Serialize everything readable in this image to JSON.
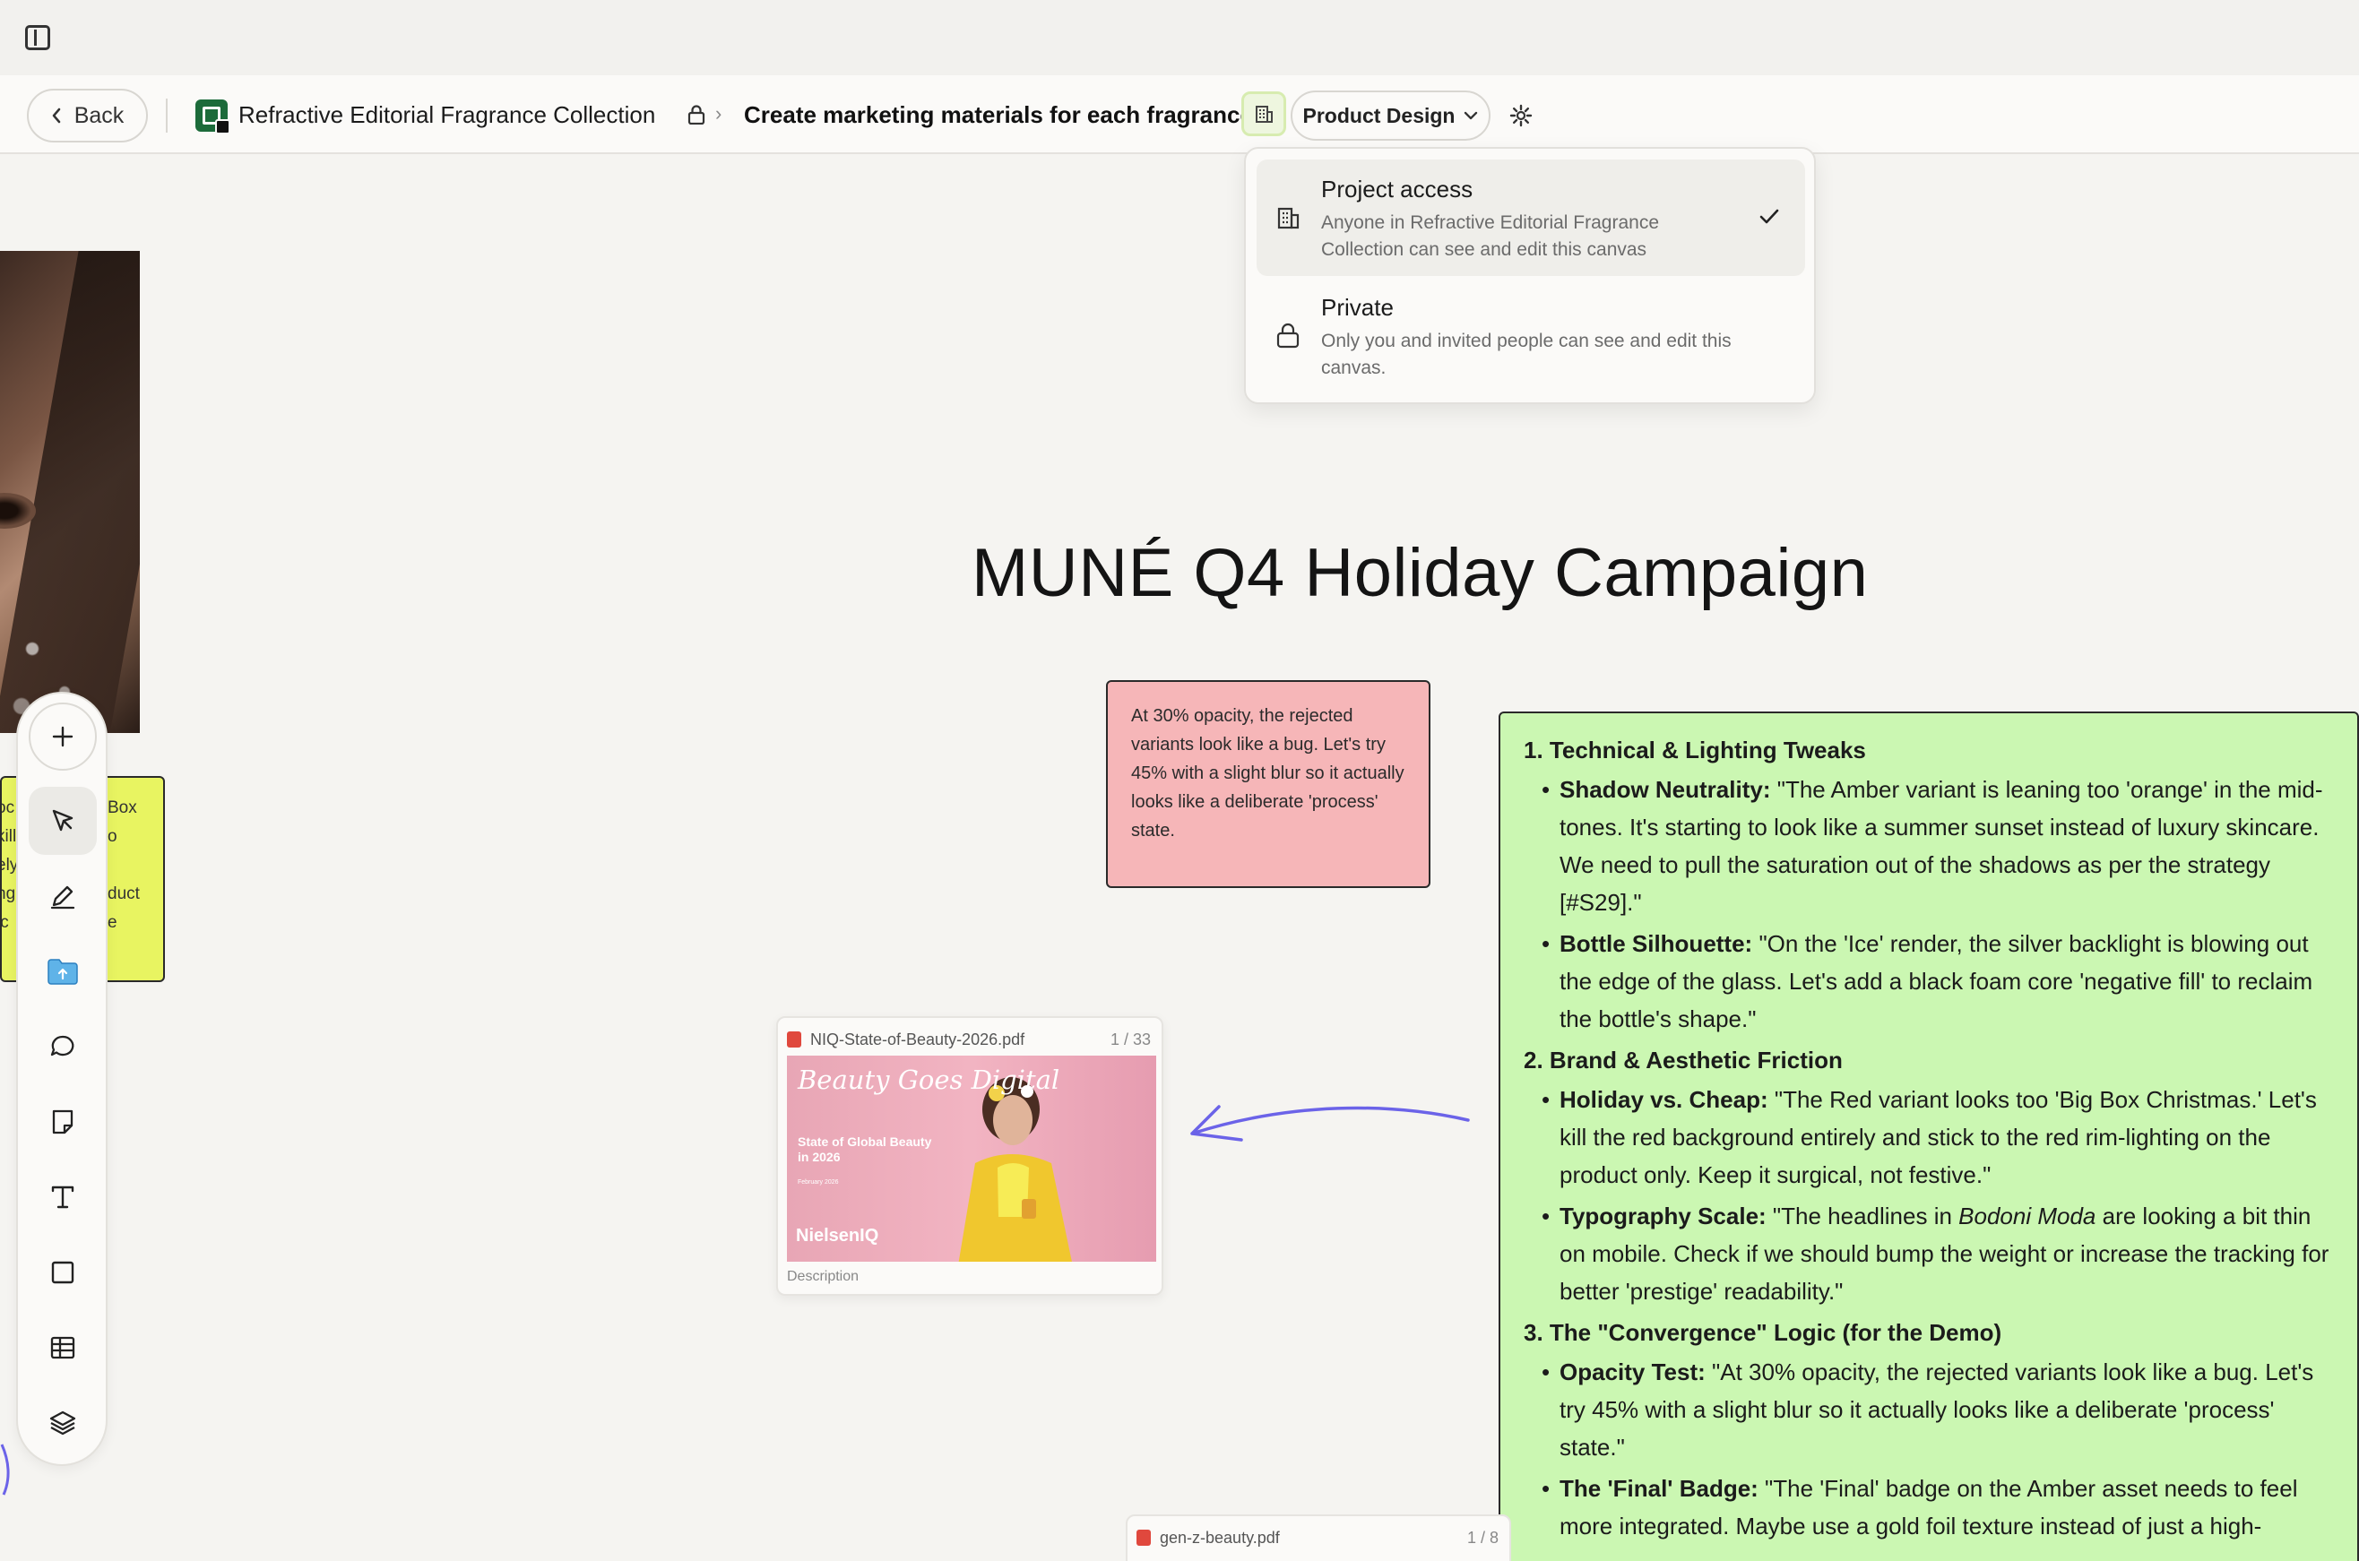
{
  "topbar": {
    "sidebar_toggle_icon": "sidebar-toggle-icon"
  },
  "header": {
    "back_label": "Back",
    "project_name": "Refractive Editorial Fragrance Collection",
    "canvas_name": "Create marketing materials for each fragrance",
    "team_label": "Product Design"
  },
  "access_menu": {
    "options": [
      {
        "title": "Project access",
        "desc": "Anyone in Refractive Editorial Fragrance Collection can see and edit this canvas",
        "selected": true,
        "icon": "building-icon"
      },
      {
        "title": "Private",
        "desc": "Only you and invited people can see and edit this canvas.",
        "selected": false,
        "icon": "lock-icon"
      }
    ]
  },
  "canvas": {
    "title": "MUNÉ Q4 Holiday Campaign",
    "sticky_yellow": {
      "left_fragments": "oc\nkill\nely\nng\nic",
      "right_fragments": "Box\no\n\nduct\ne"
    },
    "sticky_pink": "At 30% opacity, the rejected variants look like a bug. Let's try 45% with a slight blur so it actually looks like a deliberate 'process' state.",
    "notes": {
      "s1": "1. Technical & Lighting Tweaks",
      "s1_i1_k": "Shadow Neutrality:",
      "s1_i1_v": " \"The Amber variant is leaning too 'orange' in the mid-tones. It's starting to look like a summer sunset instead of luxury skincare. We need to pull the saturation out of the shadows as per the strategy [#S29].\"",
      "s1_i2_k": "Bottle Silhouette:",
      "s1_i2_v": " \"On the 'Ice' render, the silver backlight is blowing out the edge of the glass. Let's add a black foam core 'negative fill' to reclaim the bottle's shape.\"",
      "s2": "2. Brand & Aesthetic Friction",
      "s2_i1_k": "Holiday vs. Cheap:",
      "s2_i1_v": " \"The Red variant looks too 'Big Box Christmas.' Let's kill the red background entirely and stick to the red rim-lighting on the product only. Keep it surgical, not festive.\"",
      "s2_i2_k": "Typography Scale:",
      "s2_i2_a": " \"The headlines in ",
      "s2_i2_em": "Bodoni Moda",
      "s2_i2_b": " are looking a bit thin on mobile. Check if we should bump the weight or increase the tracking for better 'prestige' readability.\"",
      "s3": "3. The \"Convergence\" Logic (for the Demo)",
      "s3_i1_k": "Opacity Test:",
      "s3_i1_v": " \"At 30% opacity, the rejected variants look like a bug. Let's try 45% with a slight blur so it actually looks like a deliberate 'process' state.\"",
      "s3_i2_k": "The 'Final' Badge:",
      "s3_i2_v": " \"The 'Final' badge on the Amber asset needs to feel more integrated. Maybe use a gold foil texture instead of just a high-"
    },
    "pdf1": {
      "filename": "NIQ-State-of-Beauty-2026.pdf",
      "pages": "1 / 33",
      "cover_title": "Beauty Goes Digital",
      "cover_sub": "State of Global Beauty in 2026",
      "cover_date": "February 2026",
      "cover_brand": "NielsenIQ",
      "description": "Description"
    },
    "pdf2": {
      "filename": "gen-z-beauty.pdf",
      "pages": "1 / 8"
    }
  },
  "toolbar": {
    "tools": [
      "add-icon",
      "select-arrow-icon",
      "pen-icon",
      "upload-folder-icon",
      "comment-icon",
      "note-icon",
      "text-icon",
      "shape-icon",
      "table-icon",
      "layers-icon"
    ]
  },
  "colors": {
    "sticky_yellow": "#e8f461",
    "sticky_pink": "#f6b6b8",
    "notes_green": "#cbf7b2",
    "access_active": "#eef6df",
    "pen_stroke": "#6b63e8"
  }
}
